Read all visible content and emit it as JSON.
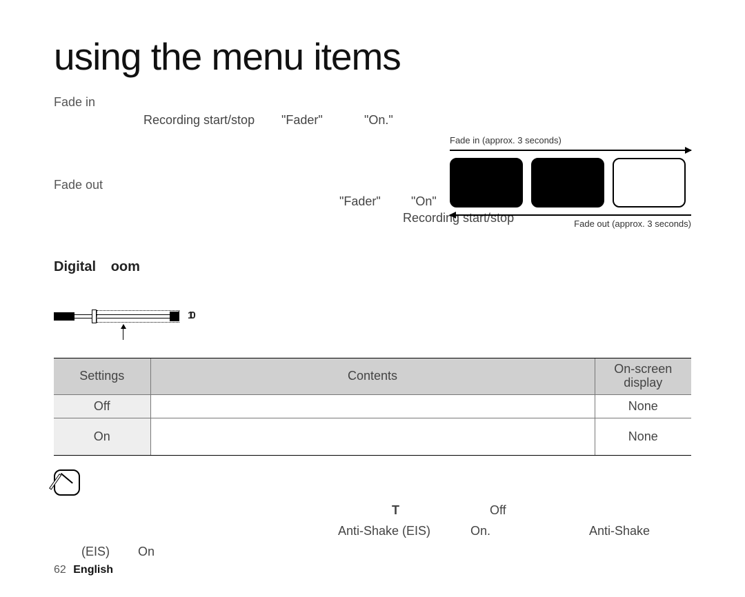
{
  "title": "using the menu items",
  "fade_in": {
    "heading": "Fade in",
    "row": {
      "a": "Recording start/stop",
      "b": "\"Fader\"",
      "c": "\"On.\""
    }
  },
  "fade_out": {
    "heading": "Fade out",
    "row": {
      "b": "\"Fader\"",
      "c": "\"On\"",
      "d": "Recording start/stop"
    }
  },
  "diagram": {
    "caption_top": "Fade in (approx. 3 seconds)",
    "caption_bottom": "Fade out (approx. 3 seconds)"
  },
  "section": {
    "title_a": "Digital",
    "title_b": "oom"
  },
  "zoom_bar": {
    "label": "10"
  },
  "table": {
    "headers": {
      "settings": "Settings",
      "contents": "Contents",
      "osd_line1": "On-screen",
      "osd_line2": "display"
    },
    "rows": [
      {
        "setting": "Off",
        "contents": "",
        "osd": "None"
      },
      {
        "setting": "On",
        "contents": "",
        "osd": "None"
      }
    ]
  },
  "notes": {
    "t": "T",
    "off": "Off",
    "antishake_eis": "Anti-Shake (EIS)",
    "on_dot": "On.",
    "antishake": "Anti-Shake",
    "eis": "(EIS)",
    "on": "On"
  },
  "footer": {
    "page": "62",
    "lang": "English"
  }
}
